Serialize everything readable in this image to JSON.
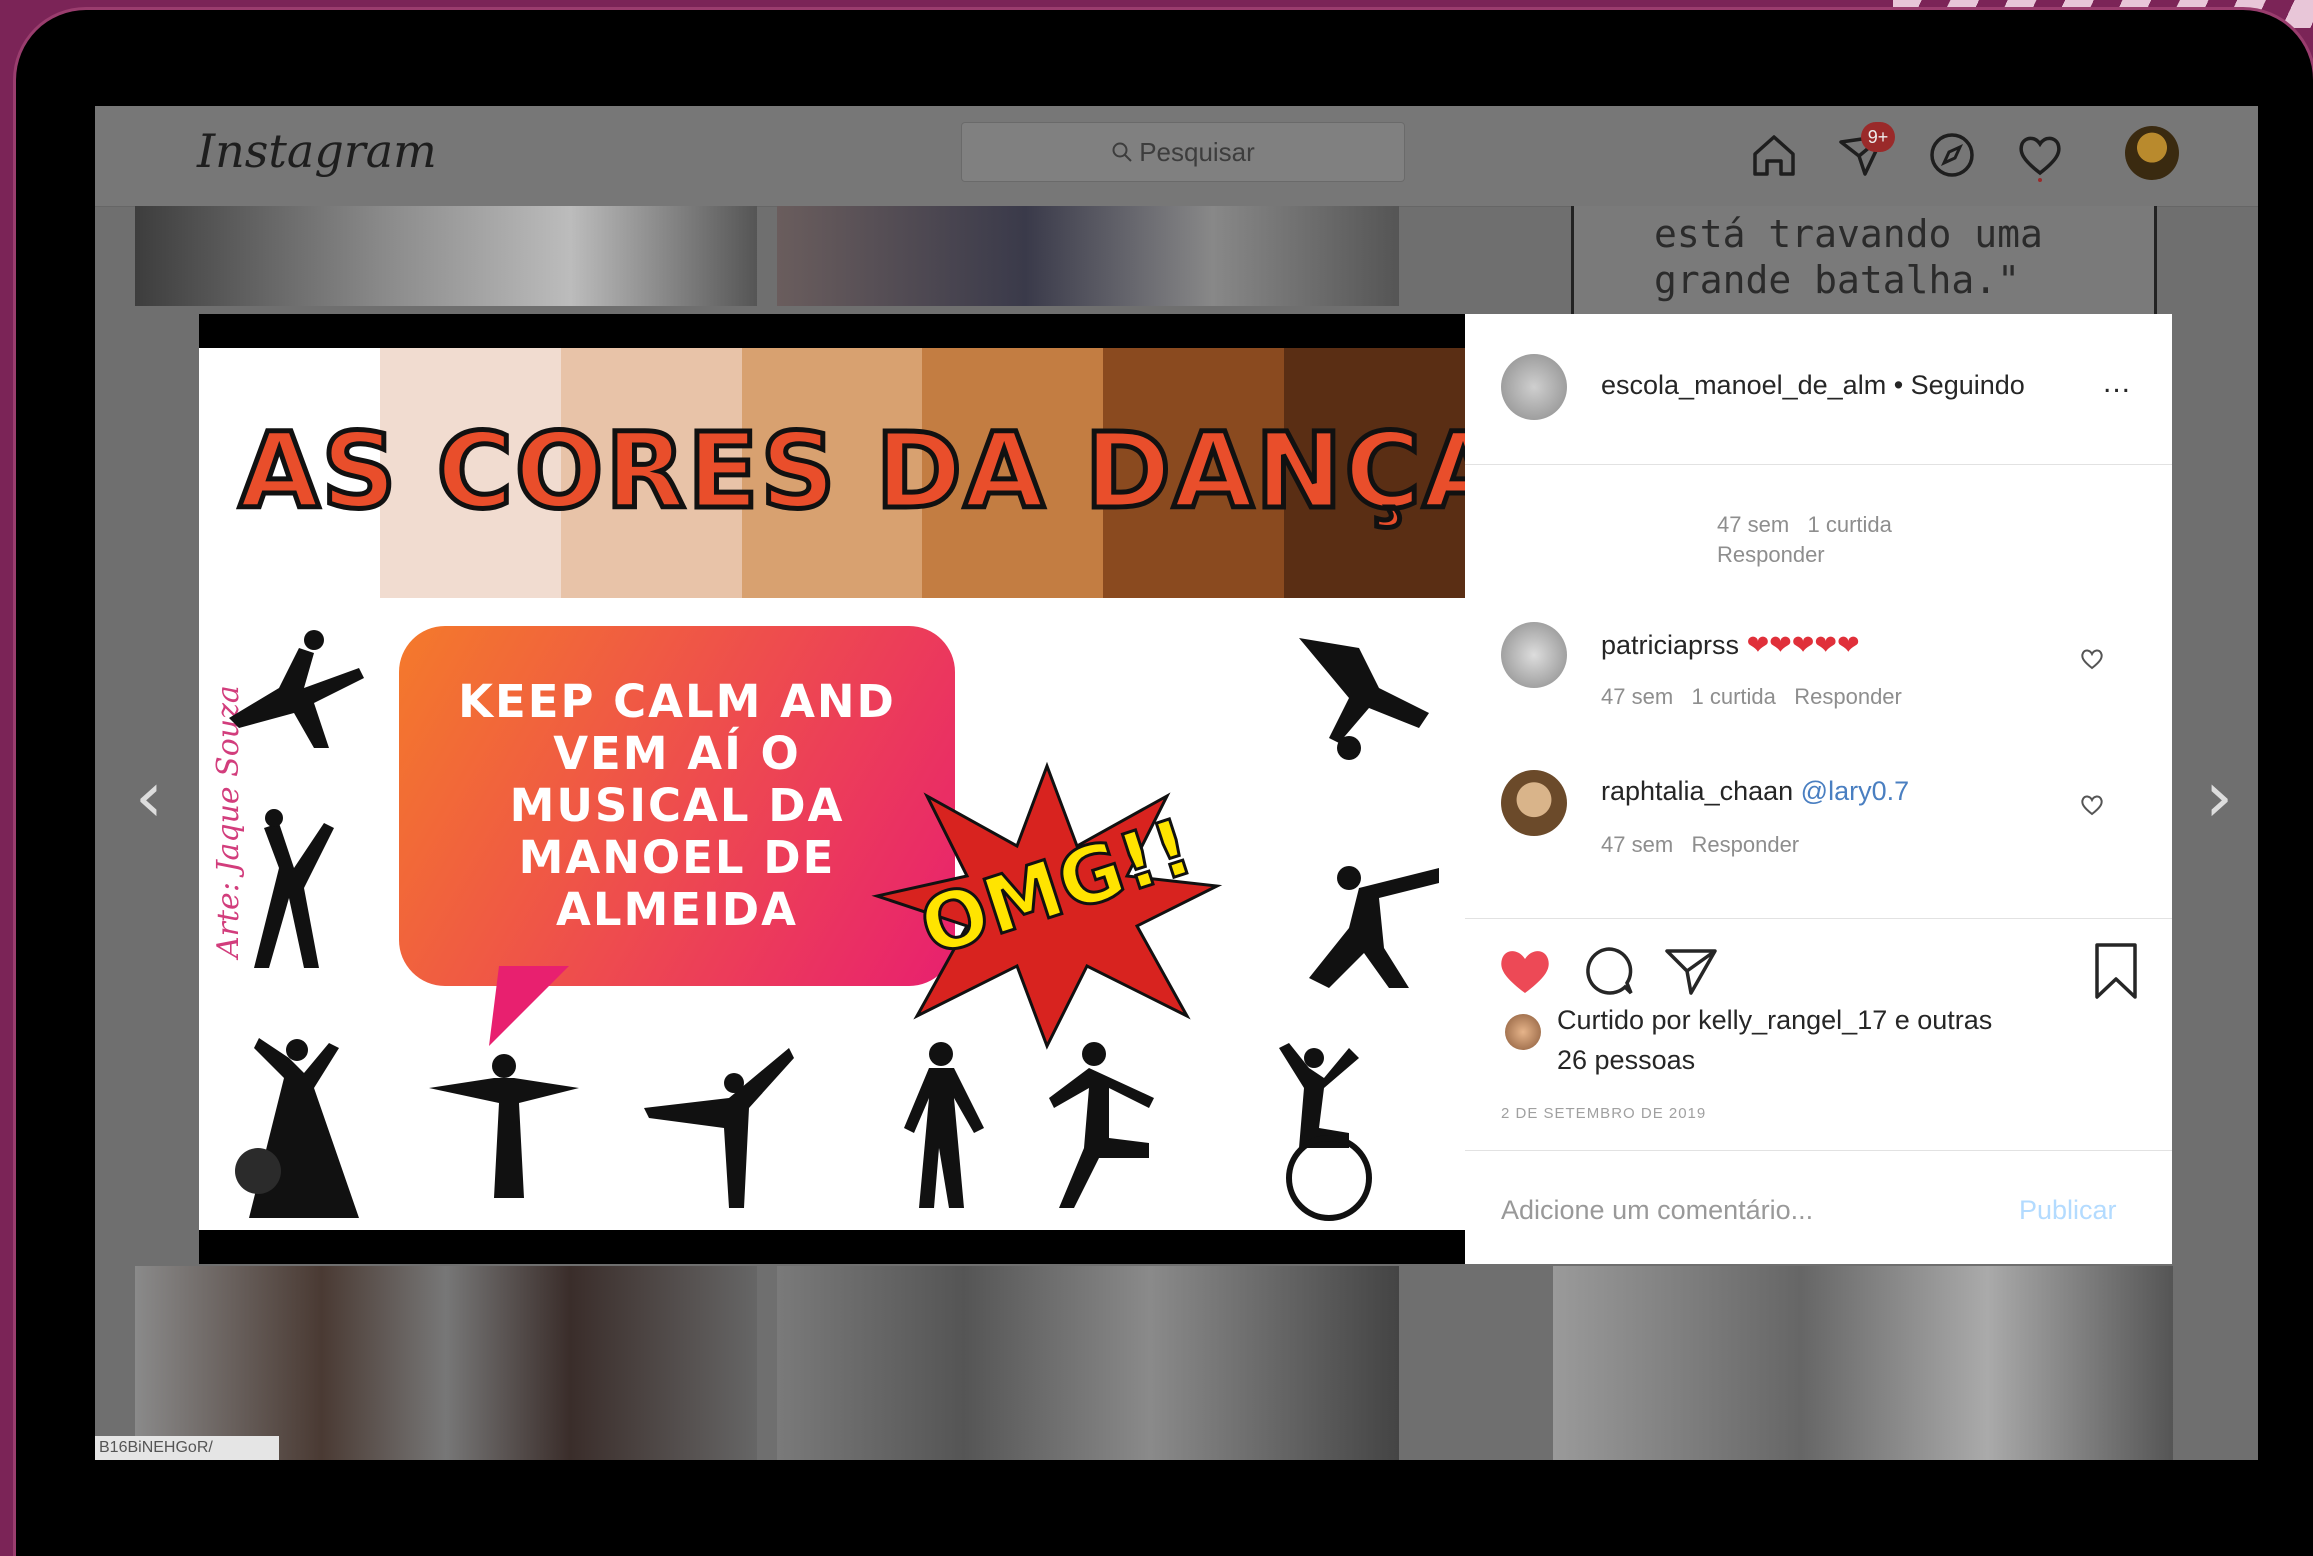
{
  "app": {
    "logo": "Instagram"
  },
  "search": {
    "placeholder": "Pesquisar"
  },
  "nav": {
    "messages_badge": "9+"
  },
  "background_tile": {
    "quote_line1": "está travando uma",
    "quote_line2": "grande batalha.\""
  },
  "post": {
    "image": {
      "title": "AS CORES DA DANÇA",
      "bubble_text": "KEEP CALM AND VEM AÍ O MUSICAL DA MANOEL DE ALMEIDA",
      "burst_text": "OMG!!",
      "signature": "Arte: Jaque Souza"
    },
    "author": {
      "username": "escola_manoel_de_alm",
      "separator": "•",
      "follow_status": "Seguindo",
      "more": "..."
    },
    "prev_comment_meta": {
      "age": "47 sem",
      "likes": "1 curtida",
      "reply": "Responder"
    },
    "comments": [
      {
        "user": "patriciaprss",
        "text": "❤❤❤❤❤",
        "age": "47 sem",
        "likes": "1 curtida",
        "reply": "Responder"
      },
      {
        "user": "raphtalia_chaan",
        "text": "@lary0.7",
        "age": "47 sem",
        "likes": "",
        "reply": "Responder"
      }
    ],
    "liked_by": {
      "prefix": "Curtido por",
      "user": "kelly_rangel_17",
      "suffix": "e outras 26 pessoas"
    },
    "date": "2 DE SETEMBRO DE 2019",
    "add_comment": {
      "placeholder": "Adicione um comentário...",
      "publish": "Publicar"
    }
  },
  "status_url": "B16BiNEHGoR/",
  "colors": {
    "heart": "#ed4956",
    "link": "#0095f6",
    "frame": "#7b2457"
  }
}
